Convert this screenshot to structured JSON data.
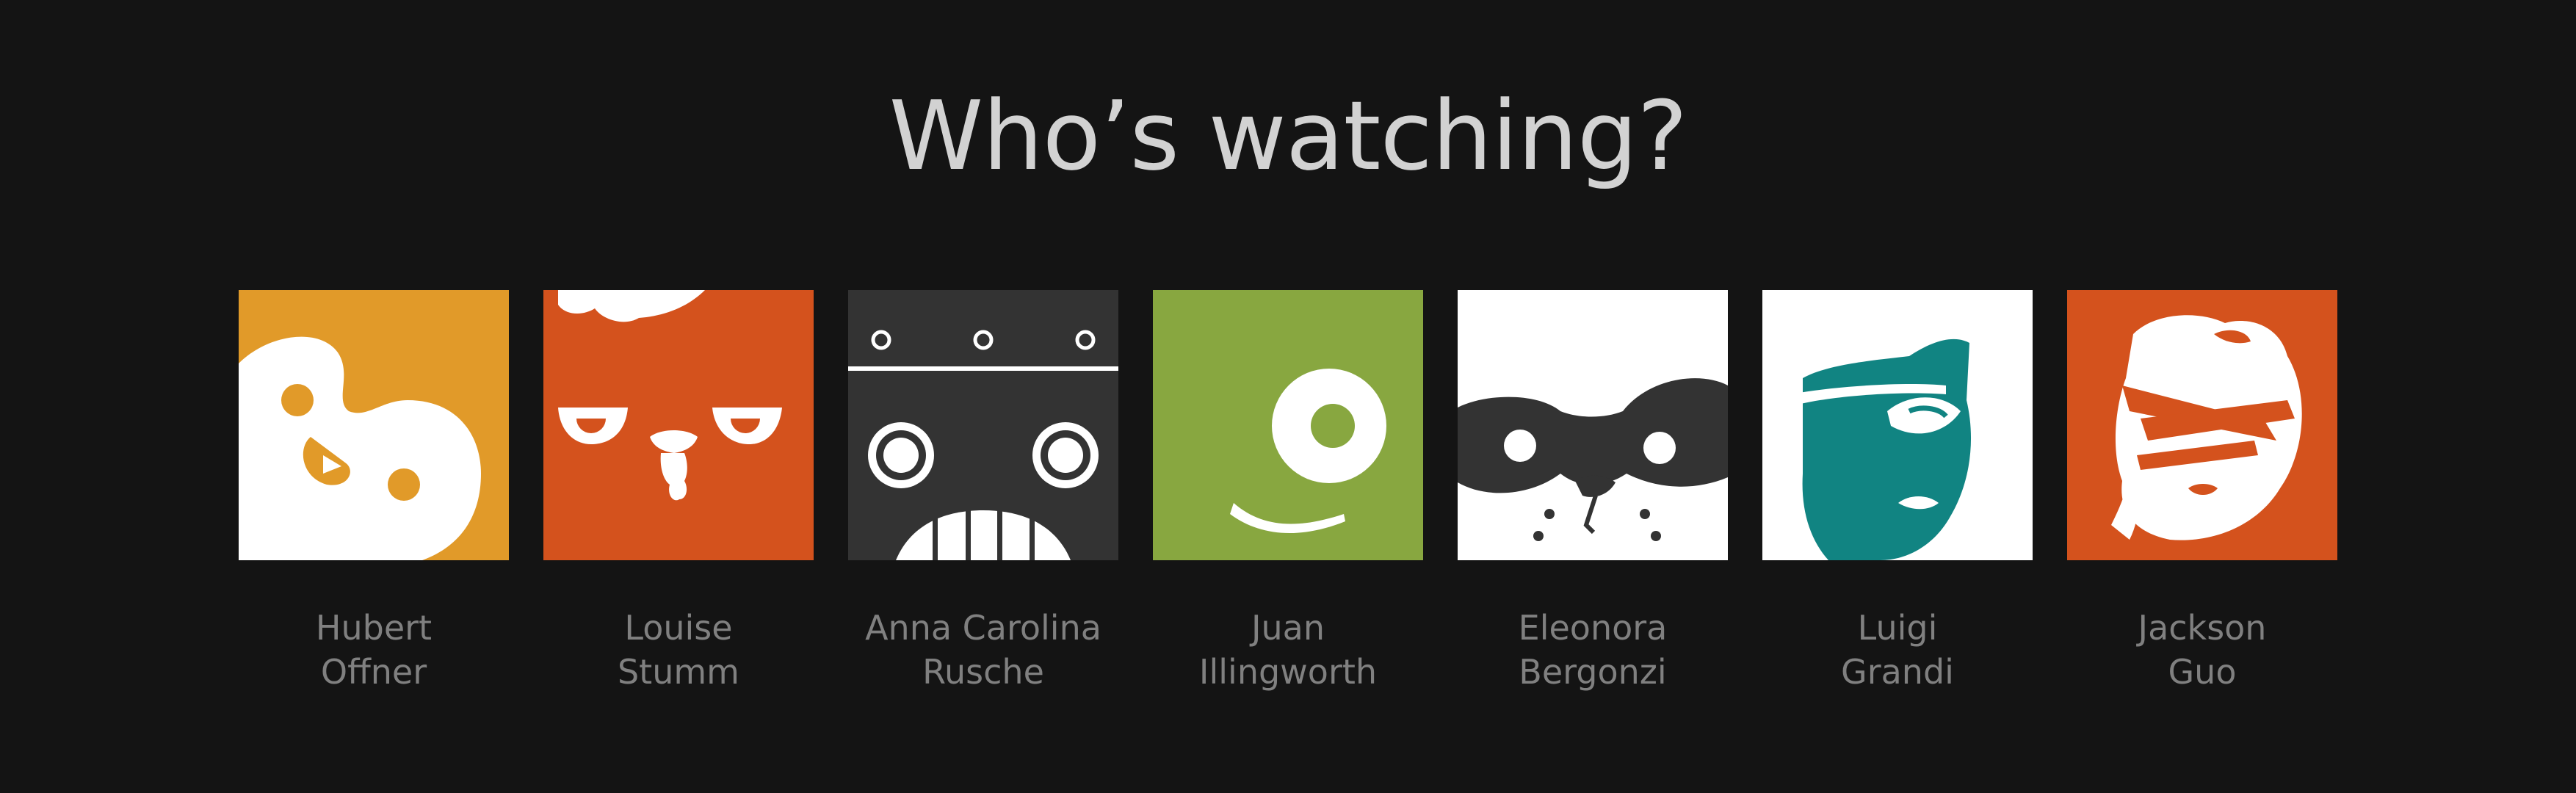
{
  "title": "Who’s watching?",
  "colors": {
    "background": "#141414",
    "title": "#d2d2d2",
    "name": "#808080"
  },
  "profiles": [
    {
      "line1": "Hubert",
      "line2": "Offner",
      "avatar_icon": "yellow-smiley-avatar-icon",
      "color": "#e19a29"
    },
    {
      "line1": "Louise",
      "line2": "Stumm",
      "avatar_icon": "red-chicken-avatar-icon",
      "color": "#d4521d"
    },
    {
      "line1": "Anna Carolina",
      "line2": "Rusche",
      "avatar_icon": "dark-robot-avatar-icon",
      "color": "#333333"
    },
    {
      "line1": "Juan",
      "line2": "Illingworth",
      "avatar_icon": "green-cyclops-avatar-icon",
      "color": "#88a740"
    },
    {
      "line1": "Eleonora",
      "line2": "Bergonzi",
      "avatar_icon": "masked-dog-avatar-icon",
      "color": "#ffffff"
    },
    {
      "line1": "Luigi",
      "line2": "Grandi",
      "avatar_icon": "teal-pirate-avatar-icon",
      "color": "#118482"
    },
    {
      "line1": "Jackson",
      "line2": "Guo",
      "avatar_icon": "orange-bandana-avatar-icon",
      "color": "#d4521d"
    }
  ]
}
